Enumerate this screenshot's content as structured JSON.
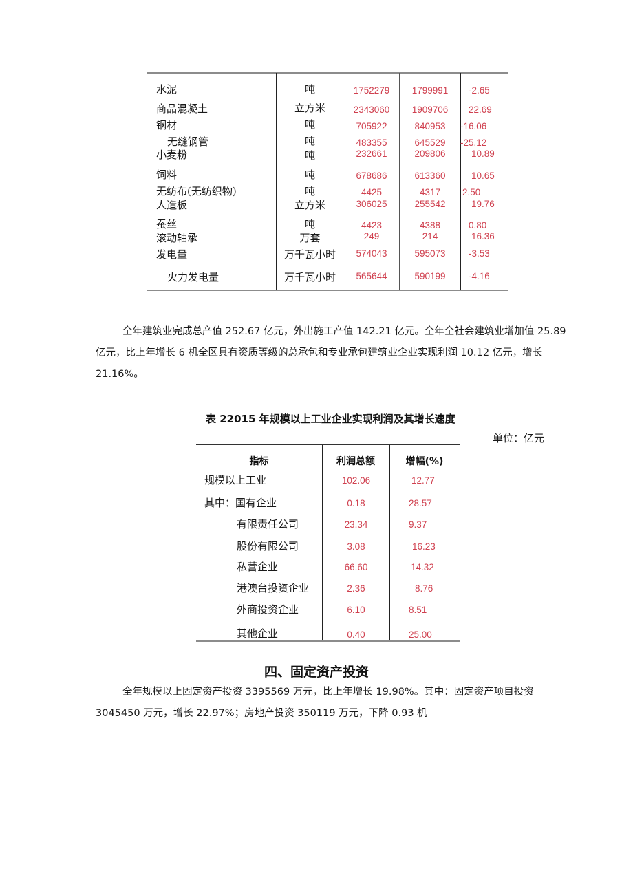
{
  "table1": {
    "rows": [
      {
        "name": "水泥",
        "unit": "吨",
        "current": "1752279",
        "previous": "1799991",
        "growth": "-2.65",
        "indent": false
      },
      {
        "name": "商品混凝土",
        "unit": "立方米",
        "current": "2343060",
        "previous": "1909706",
        "growth": "22.69",
        "indent": false
      },
      {
        "name": "钢材",
        "unit": "吨",
        "current": "705922",
        "previous": "840953",
        "growth": "-16.06",
        "indent": false
      },
      {
        "name": "无缝钢管",
        "unit": "吨",
        "current": "483355",
        "previous": "645529",
        "growth": "-25.12",
        "indent": true
      },
      {
        "name": "小麦粉",
        "unit": "吨",
        "current": "232661",
        "previous": "209806",
        "growth": "10.89",
        "indent": false
      },
      {
        "name": "饲料",
        "unit": "吨",
        "current": "678686",
        "previous": "613360",
        "growth": "10.65",
        "indent": false
      },
      {
        "name": "无纺布(无纺织物)",
        "unit": "吨",
        "current": "4425",
        "previous": "4317",
        "growth": "2.50",
        "indent": false
      },
      {
        "name": "人造板",
        "unit": "立方米",
        "current": "306025",
        "previous": "255542",
        "growth": "19.76",
        "indent": false
      },
      {
        "name": "蚕丝",
        "unit": "吨",
        "current": "4423",
        "previous": "4388",
        "growth": "0.80",
        "indent": false
      },
      {
        "name": "滚动轴承",
        "unit": "万套",
        "current": "249",
        "previous": "214",
        "growth": "16.36",
        "indent": false
      },
      {
        "name": "发电量",
        "unit": "万千瓦小时",
        "current": "574043",
        "previous": "595073",
        "growth": "-3.53",
        "indent": false
      },
      {
        "name": "火力发电量",
        "unit": "万千瓦小时",
        "current": "565644",
        "previous": "590199",
        "growth": "-4.16",
        "indent": true
      }
    ]
  },
  "paragraph1": {
    "line1": "全年建筑业完成总产值 252.67 亿元，外出施工产值 142.21 亿元。全年全社会建筑业增加值 25.89",
    "line2": "亿元，比上年增长 6 机全区具有资质等级的总承包和专业承包建筑业企业实现利润 10.12 亿元，增长",
    "line3": "21.16%。"
  },
  "table2": {
    "title": "表 22015 年规模以上工业企业实现利润及其增长速度",
    "unit": "单位：亿元",
    "headers": [
      "指标",
      "利润总额",
      "增幅(%)"
    ],
    "rows": [
      {
        "name": "规模以上工业",
        "profit": "102.06",
        "growth": "12.77",
        "indent": false
      },
      {
        "name": "其中：国有企业",
        "profit": "0.18",
        "growth": "28.57",
        "indent": false
      },
      {
        "name": "有限责任公司",
        "profit": "23.34",
        "growth": "9.37",
        "indent": true
      },
      {
        "name": "股份有限公司",
        "profit": "3.08",
        "growth": "16.23",
        "indent": true
      },
      {
        "name": "私营企业",
        "profit": "66.60",
        "growth": "14.32",
        "indent": true
      },
      {
        "name": "港澳台投资企业",
        "profit": "2.36",
        "growth": "8.76",
        "indent": true
      },
      {
        "name": "外商投资企业",
        "profit": "6.10",
        "growth": "8.51",
        "indent": true
      },
      {
        "name": "其他企业",
        "profit": "0.40",
        "growth": "25.00",
        "indent": true
      }
    ]
  },
  "section4": {
    "title": "四、固定资产投资",
    "line1": "全年规模以上固定资产投资 3395569 万元，比上年增长 19.98%。其中：固定资产项目投资",
    "line2": "3045450 万元，增长 22.97%；房地产投资 350119 万元，下降 0.93 机"
  },
  "colors": {
    "value_red": "#d0404f",
    "text": "#1a1a1a",
    "rule_gray": "#8c8c8c"
  }
}
